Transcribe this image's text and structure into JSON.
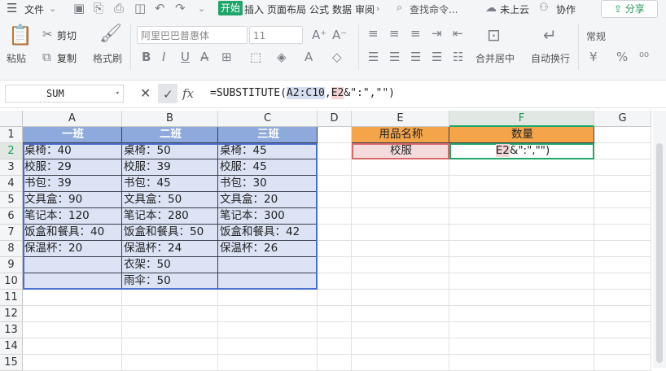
{
  "menubar": {
    "file": "文件",
    "tab_active": "开始",
    "tabs": [
      "插入",
      "页面布局",
      "公式",
      "数据",
      "审阅"
    ],
    "search": "查找命令...",
    "cloud": "未上云",
    "collab": "协作",
    "share": "分享"
  },
  "ribbon": {
    "paste": "粘贴",
    "cut": "剪切",
    "copy": "复制",
    "format_painter": "格式刷",
    "font_name": "阿里巴巴普惠体",
    "font_size": "11",
    "merge_center": "合并居中",
    "wrap_text": "自动换行",
    "number_format": "常规"
  },
  "formula_bar": {
    "name_box": "SUM",
    "fx": "fx",
    "formula_prefix": "=SUBSTITUTE(",
    "ref1": "A2:C10",
    "comma": ",",
    "ref2": "E2",
    "formula_suffix": "&\":\",\"\")"
  },
  "columns": [
    "A",
    "B",
    "C",
    "D",
    "E",
    "F",
    "G"
  ],
  "rows": [
    "1",
    "2",
    "3",
    "4",
    "5",
    "6",
    "7",
    "8",
    "9",
    "10",
    "11",
    "12",
    "13",
    "14",
    "15"
  ],
  "table": {
    "headers": [
      "一班",
      "二班",
      "三班"
    ],
    "col_a": [
      "桌椅：40",
      "校服：29",
      "书包：39",
      "文具盒：90",
      "笔记本：120",
      "饭盒和餐具：40",
      "保温杯：20",
      "",
      ""
    ],
    "col_b": [
      "桌椅：50",
      "校服：39",
      "书包：45",
      "文具盒：50",
      "笔记本：280",
      "饭盒和餐具：50",
      "保温杯：24",
      "衣架：50",
      "雨伞：50"
    ],
    "col_c": [
      "桌椅：45",
      "校服：45",
      "书包：30",
      "文具盒：20",
      "笔记本：300",
      "饭盒和餐具：42",
      "保温杯：26",
      "",
      ""
    ]
  },
  "side_table": {
    "header_e": "用品名称",
    "header_f": "数量",
    "e2": "校服",
    "f2_ref": "E2",
    "f2_rest": "&\":\",\"\")"
  },
  "colors": {
    "accent_green": "#1fa567",
    "blue_header": "#8ea9db",
    "blue_fill": "#dce3f5",
    "orange": "#f4a54a",
    "pink": "#f5dcdc"
  }
}
